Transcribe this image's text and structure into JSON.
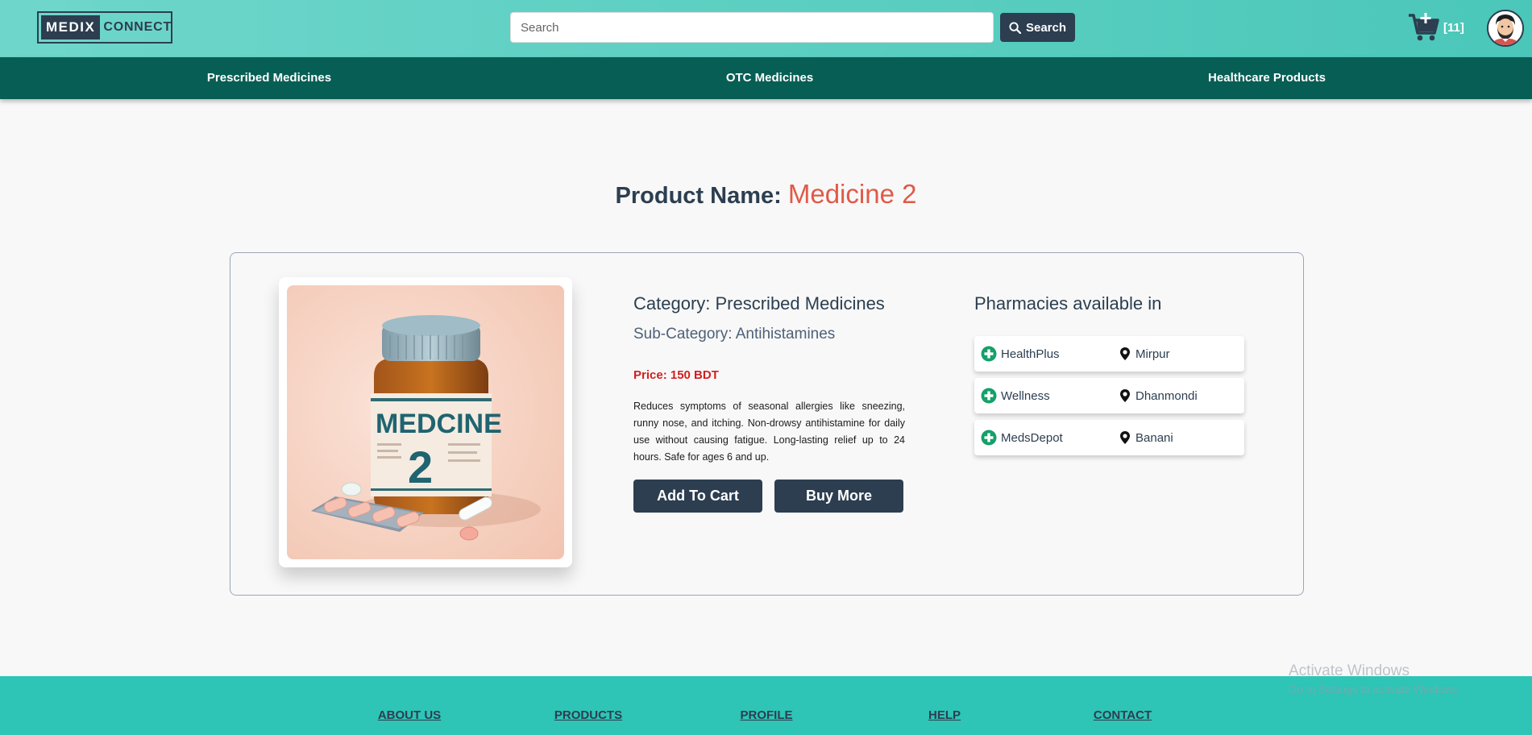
{
  "header": {
    "logo_part1": "MEDIX",
    "logo_part2": "CONNECT",
    "search_placeholder": "Search",
    "search_button_label": "Search",
    "cart_count": "[11]"
  },
  "nav": {
    "items": [
      {
        "label": "Prescribed Medicines"
      },
      {
        "label": "OTC Medicines"
      },
      {
        "label": "Healthcare Products"
      }
    ]
  },
  "product": {
    "title_label": "Product Name:",
    "name": "Medicine 2",
    "category": "Category: Prescribed Medicines",
    "subcategory": "Sub-Category: Antihistamines",
    "price": "Price: 150 BDT",
    "description": "Reduces symptoms of seasonal allergies like sneezing, runny nose, and itching. Non-drowsy antihistamine for daily use without causing fatigue. Long-lasting relief up to 24 hours. Safe for ages 6 and up.",
    "add_to_cart_label": "Add To Cart",
    "buy_more_label": "Buy More",
    "image_text_main": "MEDCINE",
    "image_text_number": "2"
  },
  "pharmacies": {
    "title": "Pharmacies available in",
    "items": [
      {
        "name": "HealthPlus",
        "location": "Mirpur"
      },
      {
        "name": "Wellness",
        "location": "Dhanmondi"
      },
      {
        "name": "MedsDepot",
        "location": "Banani"
      }
    ]
  },
  "footer": {
    "links": [
      {
        "label": "ABOUT US"
      },
      {
        "label": "PRODUCTS"
      },
      {
        "label": "PROFILE"
      },
      {
        "label": "HELP"
      },
      {
        "label": "CONTACT"
      }
    ]
  },
  "watermark": {
    "line1": "Activate Windows",
    "line2": "Go to Settings to activate Windows."
  },
  "colors": {
    "accent_dark": "#2c3e50",
    "teal_header": "#5ccfc2",
    "nav_dark_green": "#075e54",
    "price_red": "#d31f1f",
    "product_name": "#e05a47",
    "footer_teal": "#2ec4b6",
    "pharmacy_icon": "#14a06a"
  }
}
